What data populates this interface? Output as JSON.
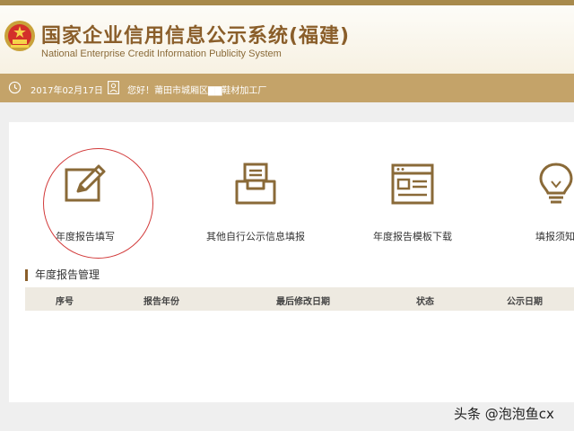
{
  "header": {
    "title": "国家企业信用信息公示系统(福建)",
    "subtitle": "National Enterprise Credit Information Publicity System"
  },
  "info_bar": {
    "date": "2017年02月17日",
    "greeting": "您好！莆田市城厢区▇▇鞋材加工厂"
  },
  "tiles": [
    {
      "label": "年度报告填写",
      "icon": "edit-pen-icon"
    },
    {
      "label": "其他自行公示信息填报",
      "icon": "inbox-document-icon"
    },
    {
      "label": "年度报告模板下载",
      "icon": "template-window-icon"
    },
    {
      "label": "填报须知",
      "icon": "lightbulb-icon"
    }
  ],
  "annual_report": {
    "section_title": "年度报告管理",
    "columns": [
      "序号",
      "报告年份",
      "最后修改日期",
      "状态",
      "公示日期"
    ]
  },
  "watermark": "头条 @泡泡鱼cx",
  "colors": {
    "brand_gold": "#c4a369",
    "brand_brown": "#8a5e2a",
    "highlight_red": "#d23a3a"
  }
}
